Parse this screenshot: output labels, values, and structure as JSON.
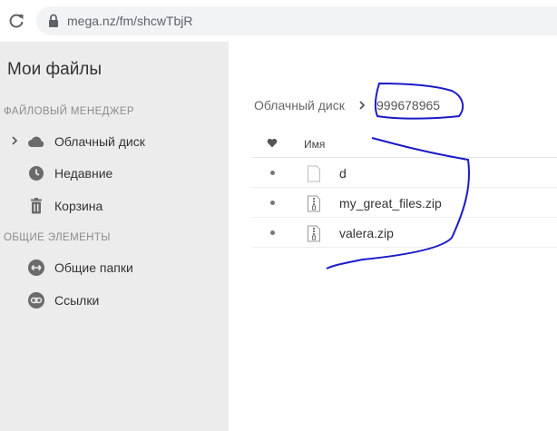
{
  "browser": {
    "url": "mega.nz/fm/shcwTbjR",
    "reload_icon": "reload-icon",
    "lock_icon": "lock-icon"
  },
  "sidebar": {
    "title": "Мои файлы",
    "section_file_manager": "ФАЙЛОВЫЙ МЕНЕДЖЕР",
    "section_shared": "ОБЩИЕ ЭЛЕМЕНТЫ",
    "items": [
      {
        "label": "Облачный диск",
        "icon": "cloud-icon"
      },
      {
        "label": "Недавние",
        "icon": "clock-icon"
      },
      {
        "label": "Корзина",
        "icon": "trash-icon"
      },
      {
        "label": "Общие папки",
        "icon": "shared-folders-icon"
      },
      {
        "label": "Ссылки",
        "icon": "link-icon"
      }
    ]
  },
  "main": {
    "breadcrumb": {
      "root": "Облачный диск",
      "current": "999678965"
    },
    "table": {
      "col_name": "Имя",
      "rows": [
        {
          "name": "d",
          "icon": "file-icon"
        },
        {
          "name": "my_great_files.zip",
          "icon": "zip-icon"
        },
        {
          "name": "valera.zip",
          "icon": "zip-icon"
        }
      ]
    }
  },
  "colors": {
    "sidebar_bg": "#ececec",
    "annotation": "#1b1bc7"
  }
}
